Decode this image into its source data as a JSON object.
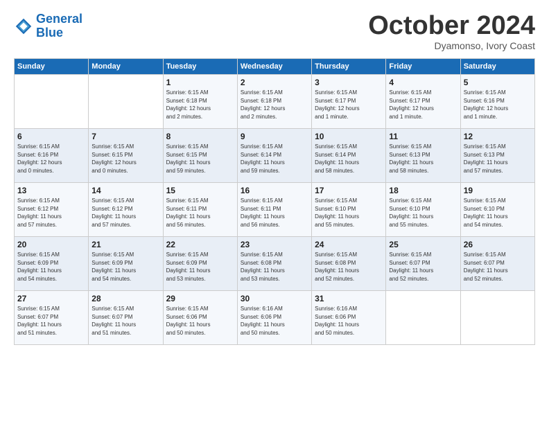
{
  "logo": {
    "line1": "General",
    "line2": "Blue"
  },
  "title": "October 2024",
  "location": "Dyamonso, Ivory Coast",
  "days_of_week": [
    "Sunday",
    "Monday",
    "Tuesday",
    "Wednesday",
    "Thursday",
    "Friday",
    "Saturday"
  ],
  "weeks": [
    [
      {
        "day": "",
        "info": ""
      },
      {
        "day": "",
        "info": ""
      },
      {
        "day": "1",
        "info": "Sunrise: 6:15 AM\nSunset: 6:18 PM\nDaylight: 12 hours\nand 2 minutes."
      },
      {
        "day": "2",
        "info": "Sunrise: 6:15 AM\nSunset: 6:18 PM\nDaylight: 12 hours\nand 2 minutes."
      },
      {
        "day": "3",
        "info": "Sunrise: 6:15 AM\nSunset: 6:17 PM\nDaylight: 12 hours\nand 1 minute."
      },
      {
        "day": "4",
        "info": "Sunrise: 6:15 AM\nSunset: 6:17 PM\nDaylight: 12 hours\nand 1 minute."
      },
      {
        "day": "5",
        "info": "Sunrise: 6:15 AM\nSunset: 6:16 PM\nDaylight: 12 hours\nand 1 minute."
      }
    ],
    [
      {
        "day": "6",
        "info": "Sunrise: 6:15 AM\nSunset: 6:16 PM\nDaylight: 12 hours\nand 0 minutes."
      },
      {
        "day": "7",
        "info": "Sunrise: 6:15 AM\nSunset: 6:15 PM\nDaylight: 12 hours\nand 0 minutes."
      },
      {
        "day": "8",
        "info": "Sunrise: 6:15 AM\nSunset: 6:15 PM\nDaylight: 11 hours\nand 59 minutes."
      },
      {
        "day": "9",
        "info": "Sunrise: 6:15 AM\nSunset: 6:14 PM\nDaylight: 11 hours\nand 59 minutes."
      },
      {
        "day": "10",
        "info": "Sunrise: 6:15 AM\nSunset: 6:14 PM\nDaylight: 11 hours\nand 58 minutes."
      },
      {
        "day": "11",
        "info": "Sunrise: 6:15 AM\nSunset: 6:13 PM\nDaylight: 11 hours\nand 58 minutes."
      },
      {
        "day": "12",
        "info": "Sunrise: 6:15 AM\nSunset: 6:13 PM\nDaylight: 11 hours\nand 57 minutes."
      }
    ],
    [
      {
        "day": "13",
        "info": "Sunrise: 6:15 AM\nSunset: 6:12 PM\nDaylight: 11 hours\nand 57 minutes."
      },
      {
        "day": "14",
        "info": "Sunrise: 6:15 AM\nSunset: 6:12 PM\nDaylight: 11 hours\nand 57 minutes."
      },
      {
        "day": "15",
        "info": "Sunrise: 6:15 AM\nSunset: 6:11 PM\nDaylight: 11 hours\nand 56 minutes."
      },
      {
        "day": "16",
        "info": "Sunrise: 6:15 AM\nSunset: 6:11 PM\nDaylight: 11 hours\nand 56 minutes."
      },
      {
        "day": "17",
        "info": "Sunrise: 6:15 AM\nSunset: 6:10 PM\nDaylight: 11 hours\nand 55 minutes."
      },
      {
        "day": "18",
        "info": "Sunrise: 6:15 AM\nSunset: 6:10 PM\nDaylight: 11 hours\nand 55 minutes."
      },
      {
        "day": "19",
        "info": "Sunrise: 6:15 AM\nSunset: 6:10 PM\nDaylight: 11 hours\nand 54 minutes."
      }
    ],
    [
      {
        "day": "20",
        "info": "Sunrise: 6:15 AM\nSunset: 6:09 PM\nDaylight: 11 hours\nand 54 minutes."
      },
      {
        "day": "21",
        "info": "Sunrise: 6:15 AM\nSunset: 6:09 PM\nDaylight: 11 hours\nand 54 minutes."
      },
      {
        "day": "22",
        "info": "Sunrise: 6:15 AM\nSunset: 6:09 PM\nDaylight: 11 hours\nand 53 minutes."
      },
      {
        "day": "23",
        "info": "Sunrise: 6:15 AM\nSunset: 6:08 PM\nDaylight: 11 hours\nand 53 minutes."
      },
      {
        "day": "24",
        "info": "Sunrise: 6:15 AM\nSunset: 6:08 PM\nDaylight: 11 hours\nand 52 minutes."
      },
      {
        "day": "25",
        "info": "Sunrise: 6:15 AM\nSunset: 6:07 PM\nDaylight: 11 hours\nand 52 minutes."
      },
      {
        "day": "26",
        "info": "Sunrise: 6:15 AM\nSunset: 6:07 PM\nDaylight: 11 hours\nand 52 minutes."
      }
    ],
    [
      {
        "day": "27",
        "info": "Sunrise: 6:15 AM\nSunset: 6:07 PM\nDaylight: 11 hours\nand 51 minutes."
      },
      {
        "day": "28",
        "info": "Sunrise: 6:15 AM\nSunset: 6:07 PM\nDaylight: 11 hours\nand 51 minutes."
      },
      {
        "day": "29",
        "info": "Sunrise: 6:15 AM\nSunset: 6:06 PM\nDaylight: 11 hours\nand 50 minutes."
      },
      {
        "day": "30",
        "info": "Sunrise: 6:16 AM\nSunset: 6:06 PM\nDaylight: 11 hours\nand 50 minutes."
      },
      {
        "day": "31",
        "info": "Sunrise: 6:16 AM\nSunset: 6:06 PM\nDaylight: 11 hours\nand 50 minutes."
      },
      {
        "day": "",
        "info": ""
      },
      {
        "day": "",
        "info": ""
      }
    ]
  ]
}
